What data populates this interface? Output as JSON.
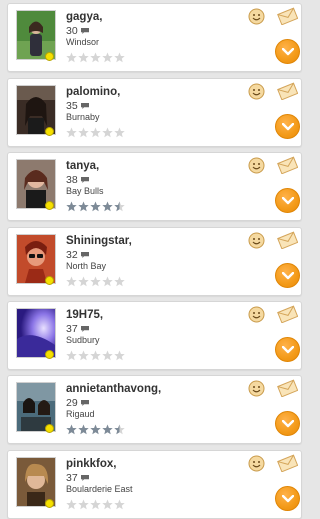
{
  "colors": {
    "accent": "#f39a18",
    "star_filled": "#7d8a97",
    "star_empty": "#d5d5d5",
    "online": "#f6e000"
  },
  "icons": {
    "smile": "smiley-face-icon",
    "message": "envelope-icon",
    "expand": "chevron-down-icon",
    "chat": "speech-bubble-icon",
    "rating": "star-icon"
  },
  "profiles": [
    {
      "name": "gagya,",
      "age": "30",
      "city": "Windsor",
      "rating": 0,
      "photo": "#4f8a3c"
    },
    {
      "name": "palomino,",
      "age": "35",
      "city": "Burnaby",
      "rating": 0,
      "photo": "#3a2c25"
    },
    {
      "name": "tanya,",
      "age": "38",
      "city": "Bay Bulls",
      "rating": 4.5,
      "photo": "#c49b88"
    },
    {
      "name": "Shiningstar,",
      "age": "32",
      "city": "North Bay",
      "rating": 0,
      "photo": "#c24b2b"
    },
    {
      "name": "19H75,",
      "age": "37",
      "city": "Sudbury",
      "rating": 0,
      "photo": "#5640c8"
    },
    {
      "name": "annietanthavong,",
      "age": "29",
      "city": "Rigaud",
      "rating": 4.5,
      "photo": "#4b6b7b"
    },
    {
      "name": "pinkkfox,",
      "age": "37",
      "city": "Boularderie East",
      "rating": 0,
      "photo": "#7a5a3a"
    }
  ]
}
